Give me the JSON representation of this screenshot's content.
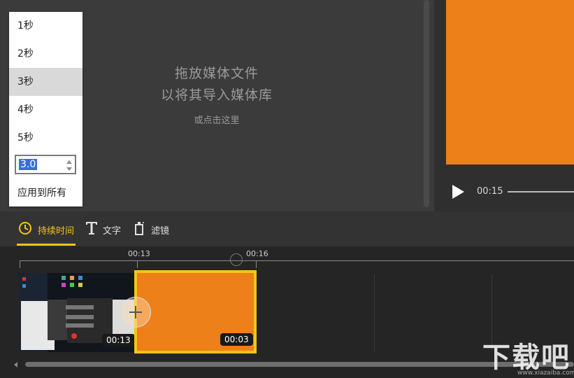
{
  "media_library": {
    "drop_line1": "拖放媒体文件",
    "drop_line2": "以将其导入媒体库",
    "click_here": "或点击这里"
  },
  "preview": {
    "time": "00:15",
    "canvas_color": "#ee8019"
  },
  "duration_dropdown": {
    "options": [
      "1秒",
      "2秒",
      "3秒",
      "4秒",
      "5秒"
    ],
    "selected": "3秒",
    "input_value": "3.0",
    "apply_all": "应用到所有"
  },
  "toolbar": {
    "tabs": [
      {
        "label": "持续时间",
        "icon": "clock-icon",
        "active": true
      },
      {
        "label": "文字",
        "icon": "text-icon",
        "active": false
      },
      {
        "label": "滤镜",
        "icon": "filter-icon",
        "active": false
      }
    ],
    "accent_color": "#f5c518"
  },
  "timeline": {
    "ticks": [
      "00:13",
      "00:16"
    ],
    "clips": [
      {
        "type": "screenshot",
        "duration": "00:13"
      },
      {
        "type": "color",
        "duration": "00:03",
        "selected": true
      }
    ]
  },
  "watermark": {
    "text": "下载吧",
    "url": "www.xiazaiba.com"
  }
}
